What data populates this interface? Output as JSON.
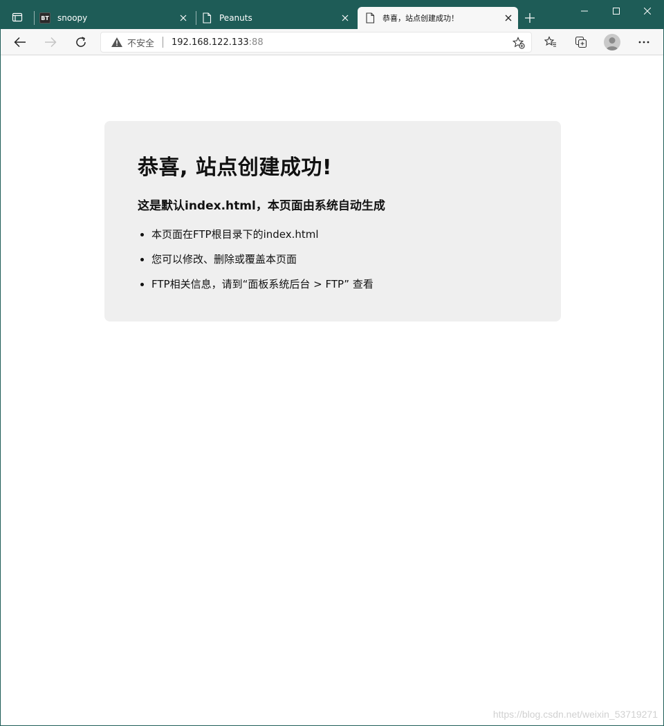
{
  "tabs": [
    {
      "title": "snoopy",
      "favicon": "BT"
    },
    {
      "title": "Peanuts",
      "favicon": "page-icon"
    },
    {
      "title": "恭喜，站点创建成功！",
      "favicon": "page-icon",
      "active": true
    }
  ],
  "addressbar": {
    "security_label": "不安全",
    "host": "192.168.122.133",
    "port": ":88"
  },
  "content": {
    "heading": "恭喜, 站点创建成功!",
    "subheading": "这是默认index.html，本页面由系统自动生成",
    "items": [
      "本页面在FTP根目录下的index.html",
      "您可以修改、删除或覆盖本页面",
      "FTP相关信息，请到“面板系统后台 > FTP” 查看"
    ]
  },
  "watermark": "https://blog.csdn.net/weixin_53719271",
  "colors": {
    "frame": "#1e5c57",
    "card_bg": "#efefef"
  }
}
